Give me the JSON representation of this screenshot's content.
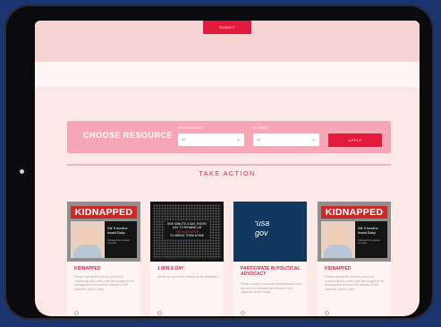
{
  "top": {
    "button_label": "SUBMIT"
  },
  "filter": {
    "title": "CHOOSE RESOURCE",
    "category_label": "BY CATEGORY",
    "category_value": "All",
    "search_label": "BY TAGS",
    "search_value": "All",
    "apply_label": "APPLY"
  },
  "section": {
    "title": "TAKE ACTION"
  },
  "cards": [
    {
      "title": "KIDNAPPED",
      "desc": "Please spread the word in your local community and online with the images of the kidnapped to demand the release of the captured held in Gaza.",
      "banner": "KIDNAPPED",
      "info": "Kfir 9 months Israeli Baby",
      "small": "Kidnapped by Hamas terrorists"
    },
    {
      "title": "1 MIN A DAY",
      "desc": "Which are you do to release of the hostages?",
      "caption_a": "ONE MINUTE A DAY, EVERY DAY TO REMIND US",
      "caption_b": "THE HOSTAGES",
      "caption_c": "TO BRING THEM HOME"
    },
    {
      "title": "PARTICIPATE IN POLITICAL ADVOCACY",
      "desc": "Please contact your local representatives and ask them to demand the release of the captured held in Gaza.",
      "logo_top": "usa",
      "logo_bottom": "gov"
    },
    {
      "title": "KIDNAPPED",
      "desc": "Please spread the word in your local community and online with the images of the kidnapped to demand the release of the captured held in Gaza.",
      "banner": "KIDNAPPED",
      "info": "Kfir 9 months Israeli Baby",
      "small": "Kidnapped by Hamas terrorists"
    }
  ],
  "colors": {
    "accent": "#e3193d",
    "filter_bg": "#f7a6b5",
    "page_bg": "#fde8e8",
    "frame_bg": "#1c3470"
  }
}
